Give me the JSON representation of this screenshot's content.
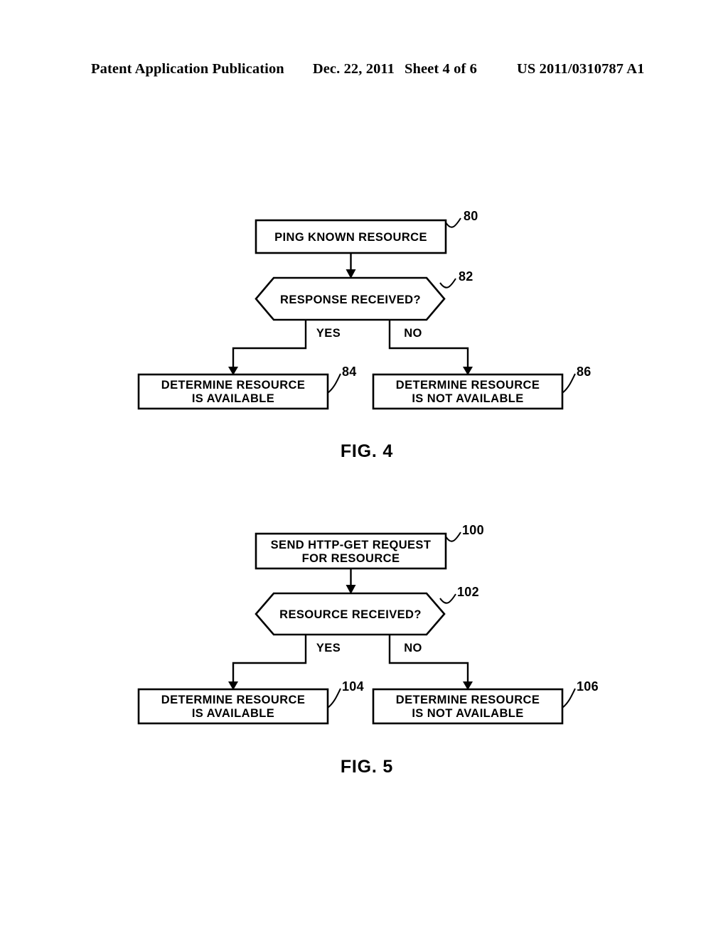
{
  "header": {
    "publication": "Patent Application Publication",
    "date": "Dec. 22, 2011",
    "sheet": "Sheet 4 of 6",
    "patent_number": "US 2011/0310787 A1"
  },
  "figures": [
    {
      "caption": "FIG. 4",
      "nodes": {
        "start": {
          "label_line1": "PING KNOWN RESOURCE",
          "label_line2": "",
          "ref": "80"
        },
        "decision": {
          "label_line1": "RESPONSE RECEIVED?",
          "ref": "82"
        },
        "yes_outcome": {
          "label_line1": "DETERMINE RESOURCE",
          "label_line2": "IS AVAILABLE",
          "ref": "84"
        },
        "no_outcome": {
          "label_line1": "DETERMINE RESOURCE",
          "label_line2": "IS NOT AVAILABLE",
          "ref": "86"
        }
      },
      "branches": {
        "yes": "YES",
        "no": "NO"
      }
    },
    {
      "caption": "FIG. 5",
      "nodes": {
        "start": {
          "label_line1": "SEND HTTP-GET REQUEST",
          "label_line2": "FOR RESOURCE",
          "ref": "100"
        },
        "decision": {
          "label_line1": "RESOURCE RECEIVED?",
          "ref": "102"
        },
        "yes_outcome": {
          "label_line1": "DETERMINE RESOURCE",
          "label_line2": "IS AVAILABLE",
          "ref": "104"
        },
        "no_outcome": {
          "label_line1": "DETERMINE RESOURCE",
          "label_line2": "IS NOT AVAILABLE",
          "ref": "106"
        }
      },
      "branches": {
        "yes": "YES",
        "no": "NO"
      }
    }
  ],
  "colors": {
    "ink": "#000000",
    "paper": "#ffffff"
  }
}
